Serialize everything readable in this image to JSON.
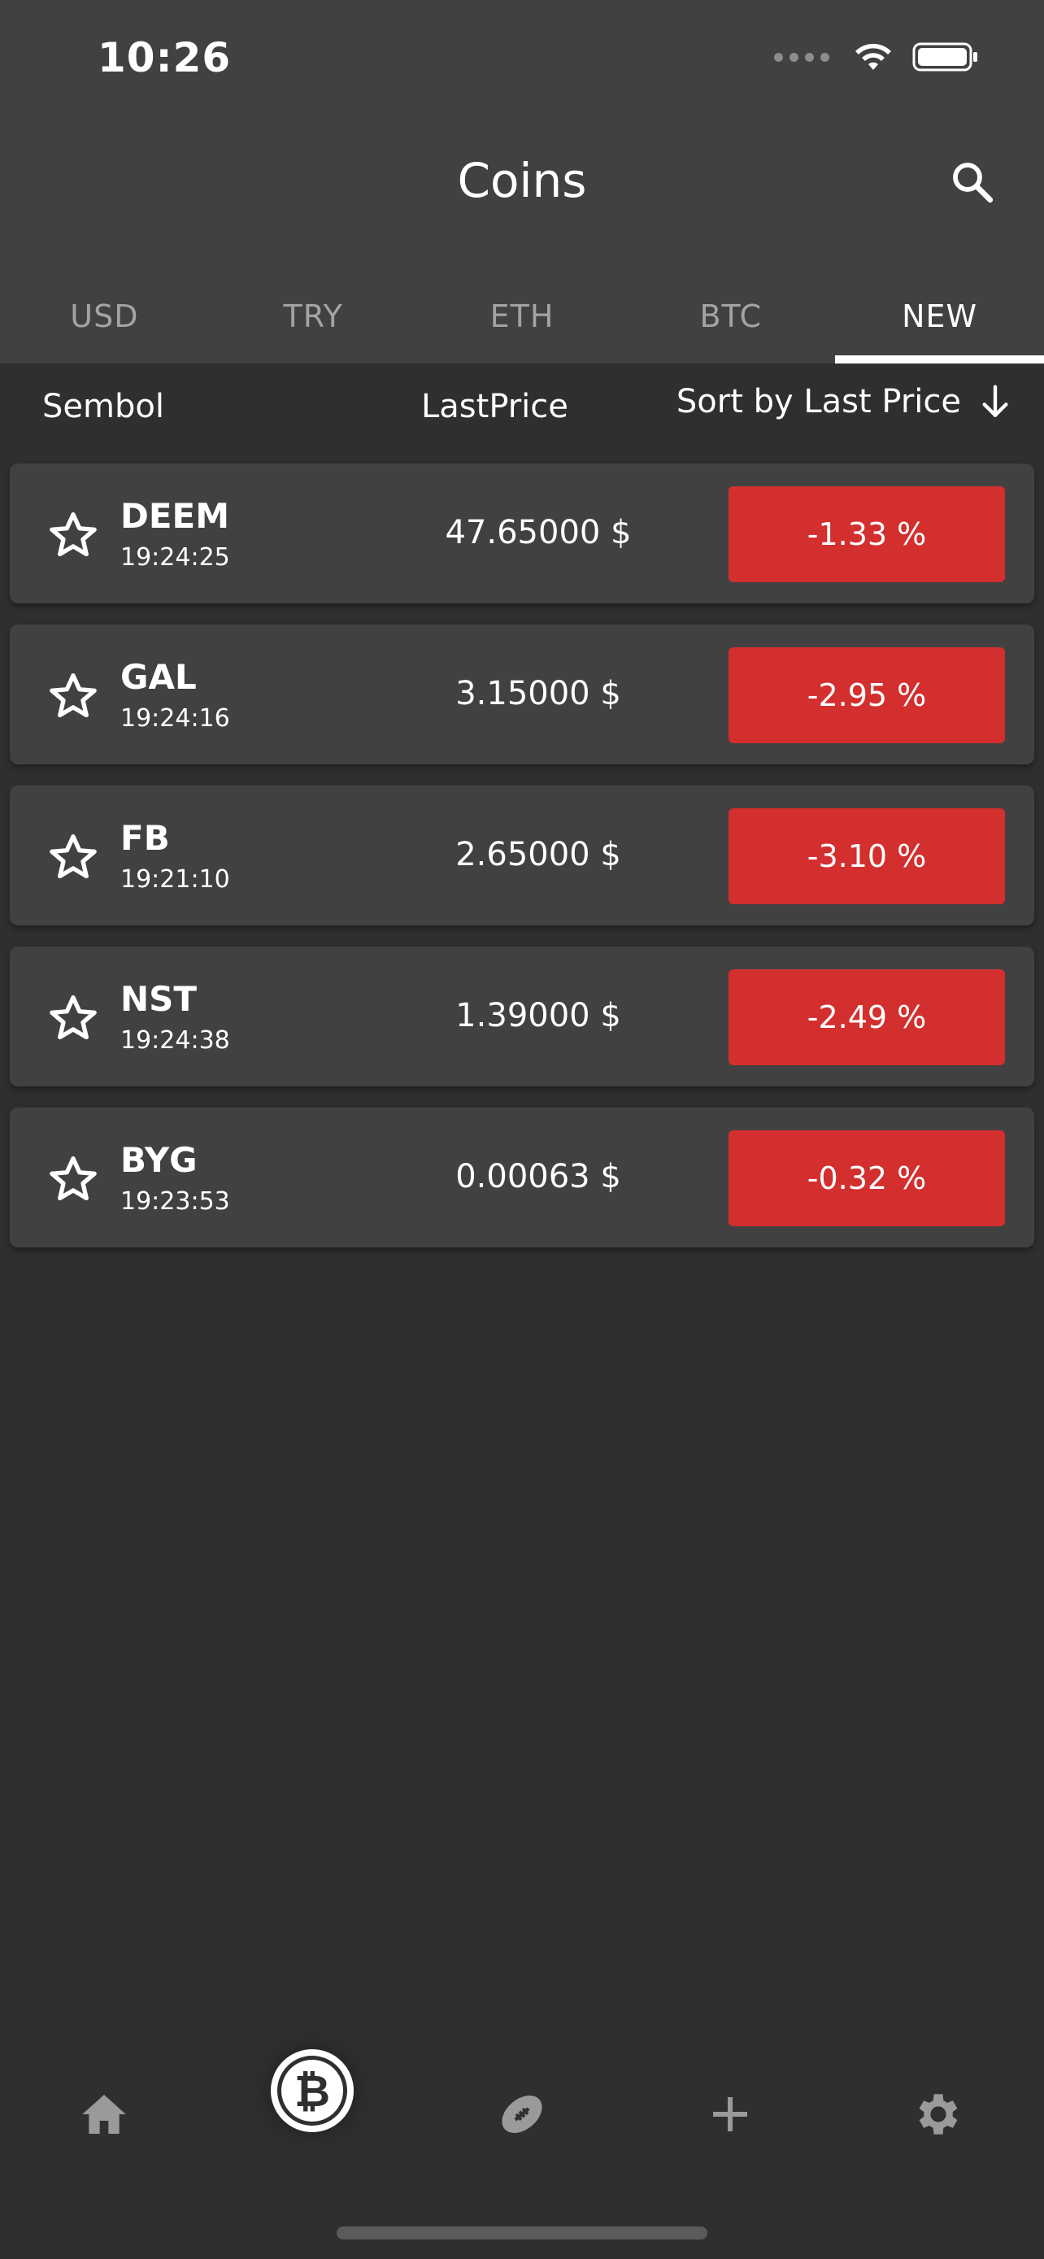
{
  "status_bar": {
    "time": "10:26"
  },
  "header": {
    "title": "Coins"
  },
  "tabs": [
    {
      "label": "USD",
      "active": false
    },
    {
      "label": "TRY",
      "active": false
    },
    {
      "label": "ETH",
      "active": false
    },
    {
      "label": "BTC",
      "active": false
    },
    {
      "label": "NEW",
      "active": true
    }
  ],
  "columns": {
    "symbol": "Sembol",
    "last_price": "LastPrice",
    "sort": "Sort by Last Price"
  },
  "rows": [
    {
      "symbol": "DEEM",
      "time": "19:24:25",
      "price": "47.65000 $",
      "change": "-1.33 %"
    },
    {
      "symbol": "GAL",
      "time": "19:24:16",
      "price": "3.15000 $",
      "change": "-2.95 %"
    },
    {
      "symbol": "FB",
      "time": "19:21:10",
      "price": "2.65000 $",
      "change": "-3.10 %"
    },
    {
      "symbol": "NST",
      "time": "19:24:38",
      "price": "1.39000 $",
      "change": "-2.49 %"
    },
    {
      "symbol": "BYG",
      "time": "19:23:53",
      "price": "0.00063 $",
      "change": "-0.32 %"
    }
  ],
  "bottom_nav": {
    "coin_symbol": "₿",
    "items": [
      "home-icon",
      "bitcoin-icon",
      "football-icon",
      "plus-icon",
      "gear-icon"
    ]
  },
  "colors": {
    "header_bg": "#414141",
    "screen_bg": "#2f2f2f",
    "row_bg": "#414141",
    "negative": "#d32f2f",
    "inactive_text": "#a3a3a3",
    "nav_icon": "#9a9a9a"
  }
}
